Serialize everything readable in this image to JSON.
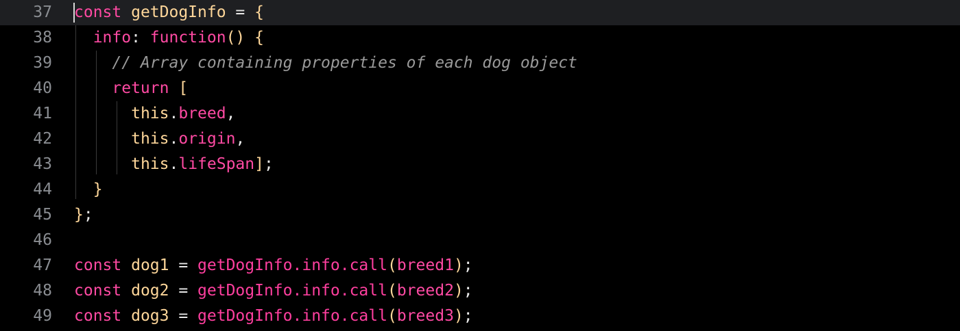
{
  "editor": {
    "lines": [
      {
        "number": "37",
        "tokens": [
          {
            "cls": "kw",
            "text": "const "
          },
          {
            "cls": "ident",
            "text": "getDogInfo"
          },
          {
            "cls": "punc",
            "text": " = "
          },
          {
            "cls": "ident",
            "text": "{"
          }
        ]
      },
      {
        "number": "38",
        "tokens": [
          {
            "cls": "punc",
            "text": "  "
          },
          {
            "cls": "kw",
            "text": "info"
          },
          {
            "cls": "punc",
            "text": ": "
          },
          {
            "cls": "kw",
            "text": "function"
          },
          {
            "cls": "ident",
            "text": "() {"
          }
        ]
      },
      {
        "number": "39",
        "tokens": [
          {
            "cls": "punc",
            "text": "    "
          },
          {
            "cls": "comment",
            "text": "// Array containing properties of each dog object"
          }
        ]
      },
      {
        "number": "40",
        "tokens": [
          {
            "cls": "punc",
            "text": "    "
          },
          {
            "cls": "kw",
            "text": "return"
          },
          {
            "cls": "punc",
            "text": " "
          },
          {
            "cls": "ident",
            "text": "["
          }
        ]
      },
      {
        "number": "41",
        "tokens": [
          {
            "cls": "punc",
            "text": "      "
          },
          {
            "cls": "ident",
            "text": "this"
          },
          {
            "cls": "punc",
            "text": "."
          },
          {
            "cls": "prop",
            "text": "breed"
          },
          {
            "cls": "punc",
            "text": ","
          }
        ]
      },
      {
        "number": "42",
        "tokens": [
          {
            "cls": "punc",
            "text": "      "
          },
          {
            "cls": "ident",
            "text": "this"
          },
          {
            "cls": "punc",
            "text": "."
          },
          {
            "cls": "prop",
            "text": "origin"
          },
          {
            "cls": "punc",
            "text": ","
          }
        ]
      },
      {
        "number": "43",
        "tokens": [
          {
            "cls": "punc",
            "text": "      "
          },
          {
            "cls": "ident",
            "text": "this"
          },
          {
            "cls": "punc",
            "text": "."
          },
          {
            "cls": "prop",
            "text": "lifeSpan"
          },
          {
            "cls": "ident",
            "text": "]"
          },
          {
            "cls": "punc",
            "text": ";"
          }
        ]
      },
      {
        "number": "44",
        "tokens": [
          {
            "cls": "punc",
            "text": "  "
          },
          {
            "cls": "ident",
            "text": "}"
          }
        ]
      },
      {
        "number": "45",
        "tokens": [
          {
            "cls": "ident",
            "text": "}"
          },
          {
            "cls": "punc",
            "text": ";"
          }
        ]
      },
      {
        "number": "46",
        "tokens": []
      },
      {
        "number": "47",
        "tokens": [
          {
            "cls": "kw",
            "text": "const "
          },
          {
            "cls": "ident",
            "text": "dog1"
          },
          {
            "cls": "punc",
            "text": " = "
          },
          {
            "cls": "call",
            "text": "getDogInfo.info.call"
          },
          {
            "cls": "ident",
            "text": "("
          },
          {
            "cls": "kw",
            "text": "breed1"
          },
          {
            "cls": "ident",
            "text": ")"
          },
          {
            "cls": "punc",
            "text": ";"
          }
        ]
      },
      {
        "number": "48",
        "tokens": [
          {
            "cls": "kw",
            "text": "const "
          },
          {
            "cls": "ident",
            "text": "dog2"
          },
          {
            "cls": "punc",
            "text": " = "
          },
          {
            "cls": "call",
            "text": "getDogInfo.info.call"
          },
          {
            "cls": "ident",
            "text": "("
          },
          {
            "cls": "kw",
            "text": "breed2"
          },
          {
            "cls": "ident",
            "text": ")"
          },
          {
            "cls": "punc",
            "text": ";"
          }
        ]
      },
      {
        "number": "49",
        "tokens": [
          {
            "cls": "kw",
            "text": "const "
          },
          {
            "cls": "ident",
            "text": "dog3"
          },
          {
            "cls": "punc",
            "text": " = "
          },
          {
            "cls": "call",
            "text": "getDogInfo.info.call"
          },
          {
            "cls": "ident",
            "text": "("
          },
          {
            "cls": "kw",
            "text": "breed3"
          },
          {
            "cls": "ident",
            "text": ")"
          },
          {
            "cls": "punc",
            "text": ";"
          }
        ]
      }
    ],
    "current_line": "37"
  },
  "colors": {
    "background": "#000000",
    "current_line_highlight": "#1e1f22",
    "keyword": "#ff4aa3",
    "identifier": "#ffd79a",
    "comment": "#9a9a9a",
    "line_number": "#8a8d92"
  }
}
